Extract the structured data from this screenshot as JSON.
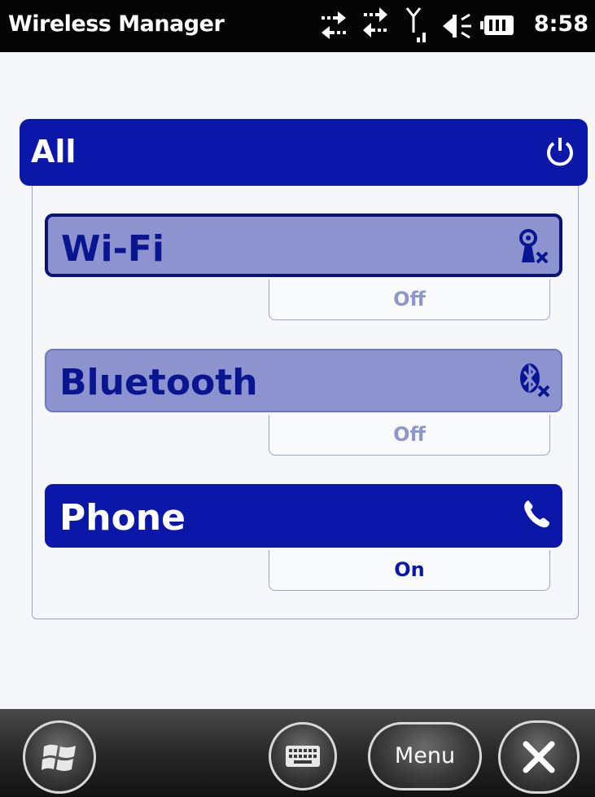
{
  "statusbar": {
    "title": "Wireless Manager",
    "time": "8:58",
    "icons": [
      "data-sync-icon",
      "signal-icon",
      "volume-icon",
      "battery-icon"
    ]
  },
  "panel": {
    "title": "All",
    "icon": "power-icon"
  },
  "radios": [
    {
      "label": "Wi-Fi",
      "state": "Off",
      "icon": "wifi-off-icon"
    },
    {
      "label": "Bluetooth",
      "state": "Off",
      "icon": "bluetooth-off-icon"
    },
    {
      "label": "Phone",
      "state": "On",
      "icon": "phone-icon"
    }
  ],
  "softkeys": {
    "start": "windows-start-icon",
    "keyboard": "keyboard-icon",
    "menu_label": "Menu",
    "close": "close-icon"
  },
  "colors": {
    "accent": "#0b17a8",
    "off_bar": "#8c93cf",
    "off_text": "#8f97c9"
  }
}
